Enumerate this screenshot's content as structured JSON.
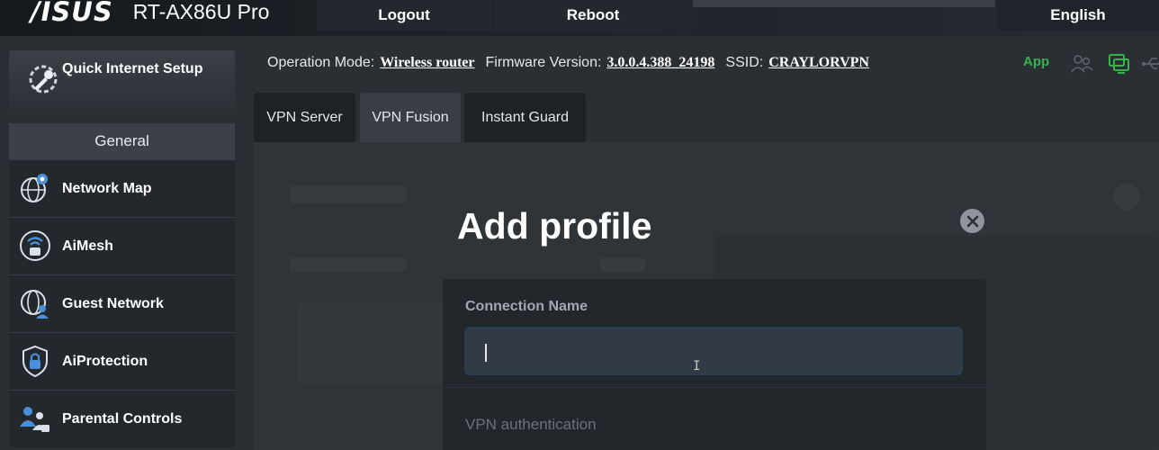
{
  "header": {
    "brand_logo": "/ISUS",
    "model": "RT-AX86U Pro",
    "logout_label": "Logout",
    "reboot_label": "Reboot",
    "language": "English"
  },
  "sidebar": {
    "quick_setup_label": "Quick Internet Setup",
    "section_title": "General",
    "items": [
      {
        "label": "Network Map",
        "icon": "network-map-icon"
      },
      {
        "label": "AiMesh",
        "icon": "aimesh-icon"
      },
      {
        "label": "Guest Network",
        "icon": "guest-network-icon"
      },
      {
        "label": "AiProtection",
        "icon": "shield-lock-icon"
      },
      {
        "label": "Parental Controls",
        "icon": "parental-controls-icon"
      }
    ]
  },
  "info_bar": {
    "operation_mode_label": "Operation Mode:",
    "operation_mode_value": "Wireless router",
    "firmware_label": "Firmware Version:",
    "firmware_value": "3.0.0.4.388_24198",
    "ssid_label": "SSID:",
    "ssid_value": "CRAYLORVPN",
    "app_label": "App",
    "accent_green": "#37b24d"
  },
  "tabs": [
    {
      "label": "VPN Server",
      "active": false
    },
    {
      "label": "VPN Fusion",
      "active": true
    },
    {
      "label": "Instant Guard",
      "active": false
    }
  ],
  "modal": {
    "title": "Add profile",
    "connection_name_label": "Connection Name",
    "connection_name_value": "",
    "vpn_auth_label": "VPN authentication"
  }
}
